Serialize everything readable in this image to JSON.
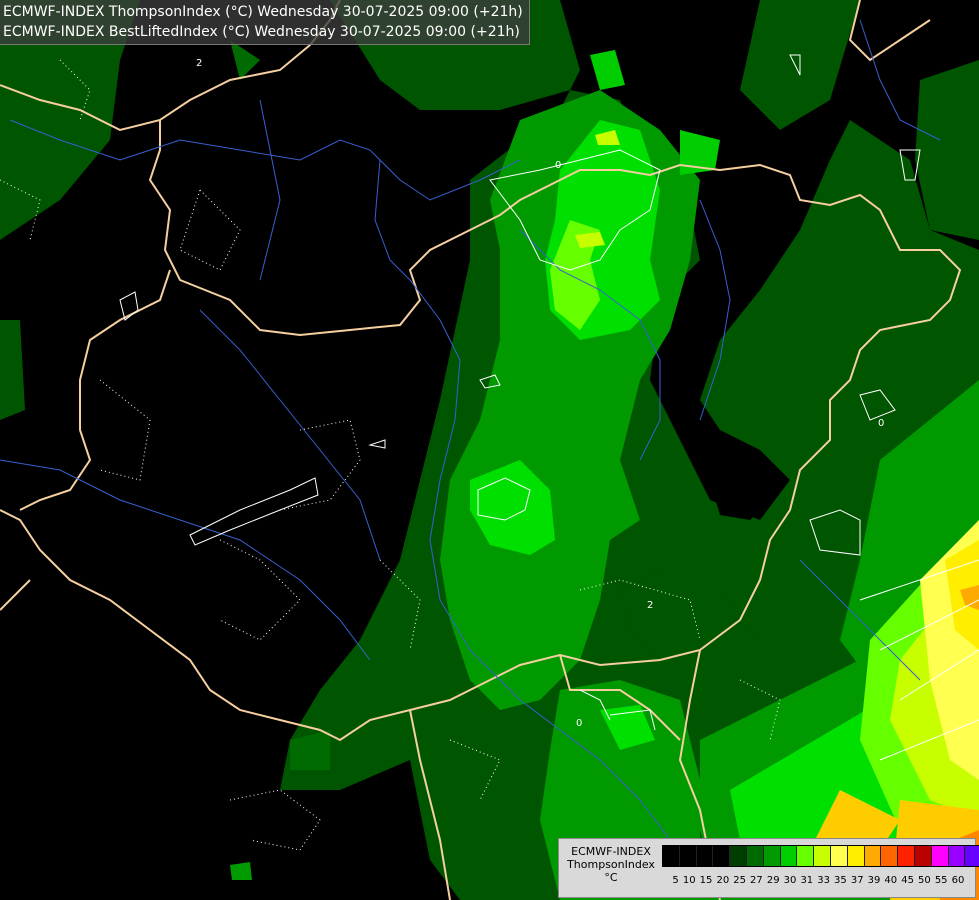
{
  "title": {
    "line1": "ECMWF-INDEX ThompsonIndex (°C) Wednesday 30-07-2025 09:00 (+21h)",
    "line2": "ECMWF-INDEX BestLiftedIndex (°C) Wednesday 30-07-2025 09:00 (+21h)"
  },
  "legend": {
    "source": "ECMWF-INDEX",
    "parameter": "ThompsonIndex",
    "unit": "°C",
    "ticks": [
      "5",
      "10",
      "15",
      "20",
      "25",
      "27",
      "29",
      "30",
      "31",
      "33",
      "35",
      "37",
      "39",
      "40",
      "45",
      "50",
      "55",
      "60"
    ],
    "colors": [
      "#000000",
      "#000000",
      "#000000",
      "#000000",
      "#003d00",
      "#006a00",
      "#009a00",
      "#00cd00",
      "#66ff00",
      "#c8ff00",
      "#ffff50",
      "#ffee00",
      "#ffaa00",
      "#ff6600",
      "#ff2200",
      "#bb0000",
      "#ff00ff",
      "#9900ff",
      "#6600ff",
      "#0000ff"
    ]
  },
  "contour_labels": {
    "a": "2",
    "b": "0",
    "c": "0",
    "d": "2",
    "e": "0"
  }
}
